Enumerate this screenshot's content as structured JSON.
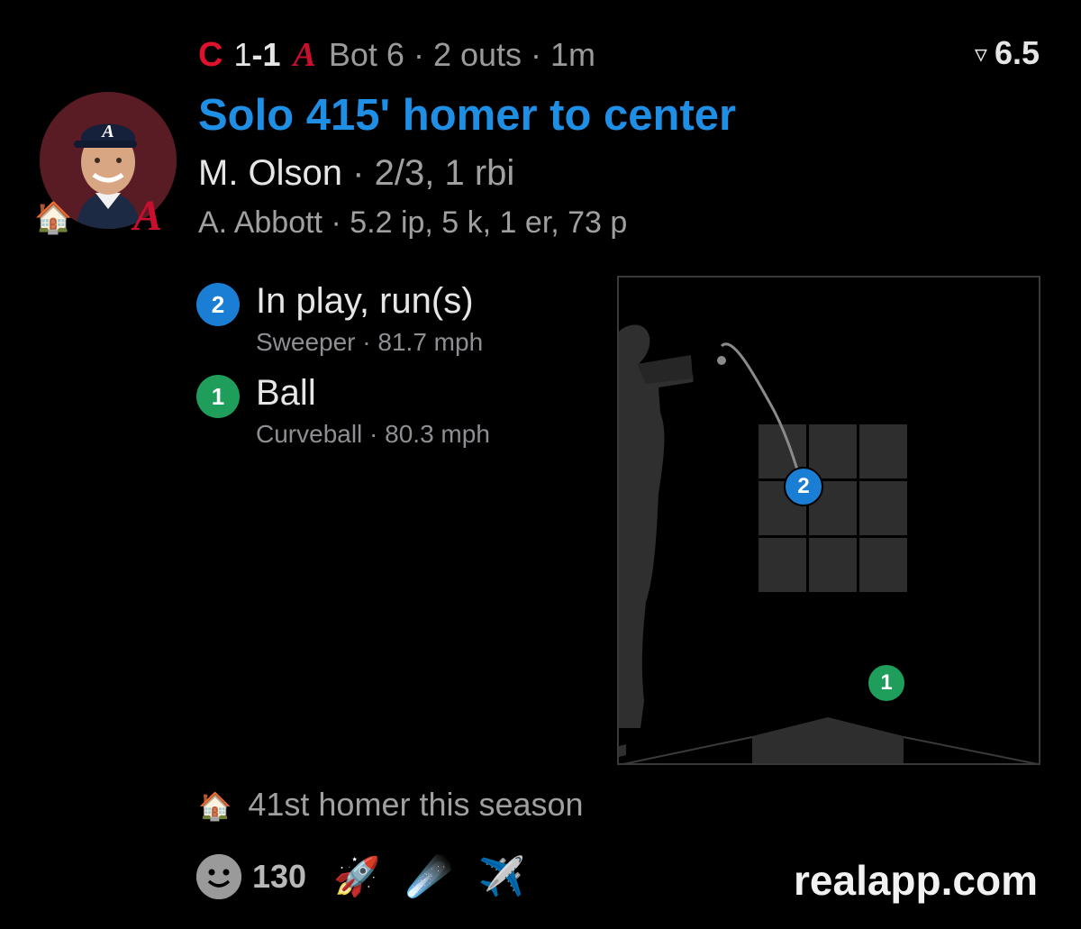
{
  "header": {
    "score_away": "1",
    "score_sep": "-",
    "score_home": "1",
    "inning": "Bot 6",
    "outs": "2 outs",
    "time_ago": "1m",
    "dot": "·",
    "odds_value": "6.5",
    "away_team_icon": "reds-c-logo",
    "home_team_icon": "braves-a-logo",
    "odds_icon": "triangle-flag-icon"
  },
  "headline": "Solo 415' homer to center",
  "batter": {
    "name": "M. Olson",
    "dot": "·",
    "stat": "2/3, 1 rbi"
  },
  "pitcher": {
    "name": "A. Abbott",
    "dot": "·",
    "stat": "5.2 ip, 5 k, 1 er, 73 p"
  },
  "avatar": {
    "icon": "player-photo",
    "badge_icon": "house-emoji",
    "team_badge_icon": "braves-a-logo"
  },
  "pitches": [
    {
      "num": "2",
      "title": "In play, run(s)",
      "detail": "Sweeper · 81.7 mph",
      "color": "#1a7fd4"
    },
    {
      "num": "1",
      "title": "Ball",
      "detail": "Curveball · 80.3 mph",
      "color": "#1e9e5a"
    }
  ],
  "strike_zone": {
    "markers": [
      {
        "num": "2",
        "color": "#1a7fd4"
      },
      {
        "num": "1",
        "color": "#1e9e5a"
      }
    ]
  },
  "footer": {
    "note_icon": "house-emoji",
    "note": "41st homer this season",
    "reaction_count": "130",
    "reaction_icons": [
      "smiley-icon",
      "rocket-emoji",
      "comet-emoji",
      "airplane-emoji"
    ],
    "brand": "realapp.com"
  }
}
